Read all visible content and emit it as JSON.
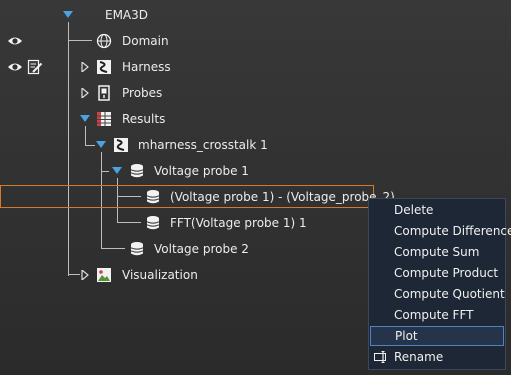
{
  "tree": {
    "root": "EMA3D",
    "domain": "Domain",
    "harness": "Harness",
    "probes": "Probes",
    "results": "Results",
    "crosstalk": "mharness_crosstalk 1",
    "voltage_probe_1": "Voltage probe 1",
    "diff_item": "(Voltage probe 1) - (Voltage_probe_2)",
    "fft_item": "FFT(Voltage probe 1) 1",
    "voltage_probe_2": "Voltage probe 2",
    "visualization": "Visualization"
  },
  "context_menu": {
    "delete": "Delete",
    "compute_difference": "Compute Difference",
    "compute_sum": "Compute Sum",
    "compute_product": "Compute Product",
    "compute_quotient": "Compute Quotient",
    "compute_fft": "Compute FFT",
    "plot": "Plot",
    "rename": "Rename"
  },
  "colors": {
    "selection_border": "#d4782a",
    "menu_background": "#1e2735",
    "menu_highlight": "#4f82c4",
    "expander": "#4aa3df"
  }
}
